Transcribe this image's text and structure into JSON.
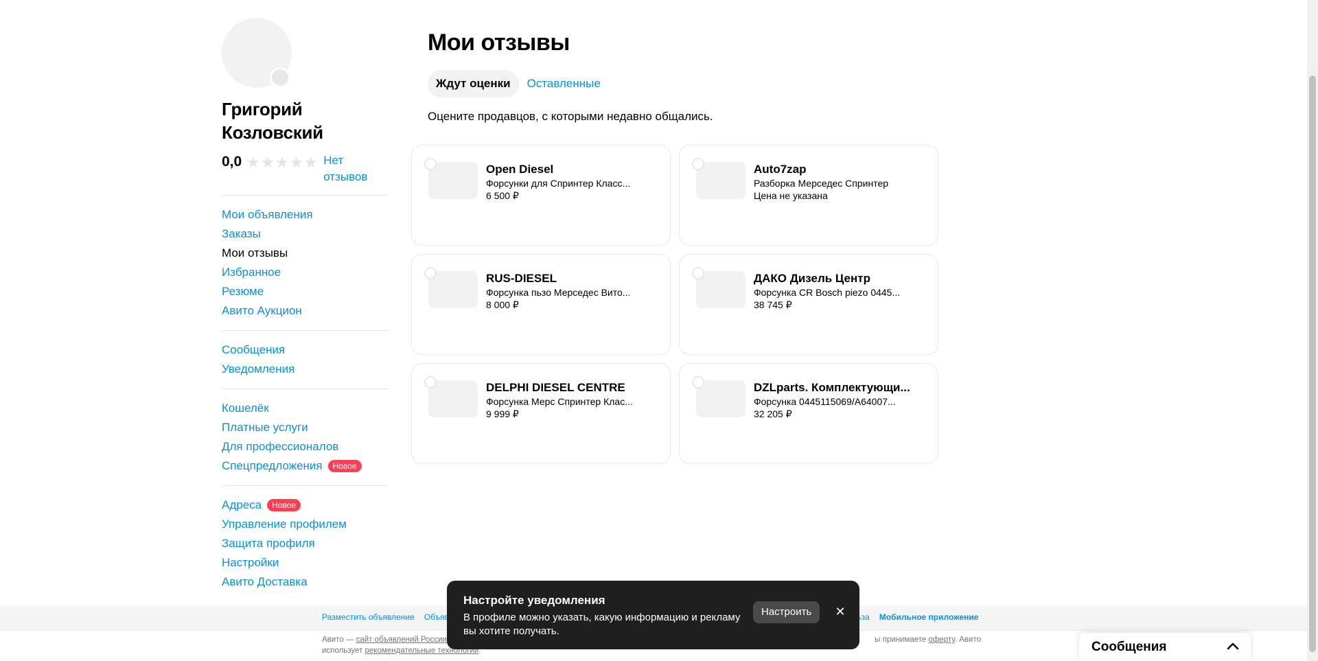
{
  "sidebar": {
    "user_name": "Григорий Козловский",
    "rating": "0,0",
    "no_reviews": "Нет отзывов",
    "groups": [
      [
        {
          "label": "Мои объявления",
          "active": false
        },
        {
          "label": "Заказы",
          "active": false
        },
        {
          "label": "Мои отзывы",
          "active": true
        },
        {
          "label": "Избранное",
          "active": false
        },
        {
          "label": "Резюме",
          "active": false
        },
        {
          "label": "Авито Аукцион",
          "active": false
        }
      ],
      [
        {
          "label": "Сообщения",
          "active": false
        },
        {
          "label": "Уведомления",
          "active": false
        }
      ],
      [
        {
          "label": "Кошелёк",
          "active": false
        },
        {
          "label": "Платные услуги",
          "active": false
        },
        {
          "label": "Для профессионалов",
          "active": false
        },
        {
          "label": "Спецпредложения",
          "active": false,
          "badge": "Новое"
        }
      ],
      [
        {
          "label": "Адреса",
          "active": false,
          "badge": "Новое"
        },
        {
          "label": "Управление профилем",
          "active": false
        },
        {
          "label": "Защита профиля",
          "active": false
        },
        {
          "label": "Настройки",
          "active": false
        },
        {
          "label": "Авито Доставка",
          "active": false
        }
      ]
    ]
  },
  "main": {
    "title": "Мои отзывы",
    "tabs": [
      {
        "label": "Ждут оценки",
        "active": true
      },
      {
        "label": "Оставленные",
        "active": false
      }
    ],
    "subtitle": "Оцените продавцов, с которыми недавно общались."
  },
  "cards": [
    {
      "seller": "Open Diesel",
      "item": "Форсунки для Спринтер Класс...",
      "price": "6 500 ₽"
    },
    {
      "seller": "Auto7zap",
      "item": "Разборка Мерседес Спринтер",
      "price": "Цена не указана"
    },
    {
      "seller": "RUS-DIESEL",
      "item": "Форсунка пьзо Мерседес Вито...",
      "price": "8 000 ₽"
    },
    {
      "seller": "ДАКО Дизель Центр",
      "item": "Форсунка CR Bosch piezo 0445...",
      "price": "38 745 ₽"
    },
    {
      "seller": "DELPHI DIESEL CENTRE",
      "item": "Форсунка Мерс Спринтер Клас...",
      "price": "9 999 ₽"
    },
    {
      "seller": "DZLparts. Комплектующи...",
      "item": "Форсунка 0445115069/A64007...",
      "price": "32 205 ₽"
    }
  ],
  "footer": {
    "link_place_ad": "Разместить объявление",
    "link_ads_partial": "Объяв",
    "link_use_partial": "ользa",
    "link_mobile": "Мобильное приложение",
    "text_line1_start": "Авито — ",
    "text_line1_link": "сайт объявлений России",
    "text_line1_end_start": "ы принимаете ",
    "text_line1_offer": "оферту",
    "text_line1_tail": ". Авито",
    "text_line2_start": "использует ",
    "text_line2_link": "рекомендательные технологии",
    "text_line2_end": "."
  },
  "toast": {
    "title": "Настройте уведомления",
    "text": "В профиле можно указать, какую информацию и рекламу вы хотите получать.",
    "button": "Настроить"
  },
  "messenger": {
    "title": "Сообщения"
  },
  "colors": {
    "link": "#0a8ee0",
    "badge": "#ff4053",
    "toast_bg": "#1f1f1f"
  }
}
